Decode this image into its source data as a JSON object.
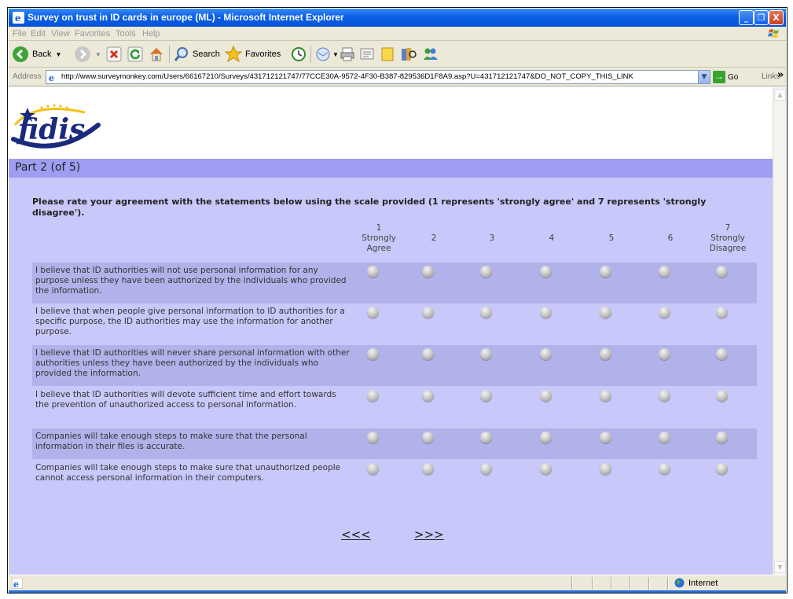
{
  "window": {
    "title": "Survey on trust in ID cards in europe (ML) - Microsoft Internet Explorer",
    "min_label": "_",
    "max_label": "❐",
    "close_label": "X"
  },
  "menu": [
    "File",
    "Edit",
    "View",
    "Favorites",
    "Tools",
    "Help"
  ],
  "toolbar": {
    "back_label": "Back",
    "search_label": "Search",
    "favorites_label": "Favorites"
  },
  "address": {
    "label": "Address",
    "url": "http://www.surveymonkey.com/Users/66167210/Surveys/431712121747/77CCE30A-9572-4F30-B387-829536D1F8A9.asp?U=431712121747&DO_NOT_COPY_THIS_LINK",
    "go_label": "Go",
    "links_label": "Links"
  },
  "page": {
    "logo_text": "fidis",
    "part_title": "Part 2 (of 5)",
    "instructions": "Please rate your agreement with the statements below using the scale provided (1 represents 'strongly agree' and 7 represents 'strongly disagree').",
    "scale": [
      {
        "num": "1",
        "label": "Strongly Agree"
      },
      {
        "num": "2",
        "label": ""
      },
      {
        "num": "3",
        "label": ""
      },
      {
        "num": "4",
        "label": ""
      },
      {
        "num": "5",
        "label": ""
      },
      {
        "num": "6",
        "label": ""
      },
      {
        "num": "7",
        "label": "Strongly Disagree"
      }
    ],
    "questions": [
      "I believe that ID authorities will not use personal information for any purpose unless they have been authorized by the individuals who provided the information.",
      "I believe that when people give personal information to ID authorities for a specific purpose, the ID authorities may use the information for another purpose.",
      "I believe that ID authorities will never share personal information with other authorities unless they have been authorized by the individuals who provided the information.",
      "I believe that ID authorities will devote sufficient time and effort towards the prevention of unauthorized access to personal information.",
      "Companies will take enough steps to make sure that the personal information in their files is accurate.",
      "Companies will take enough steps to make sure that unauthorized people cannot access personal information in their computers."
    ],
    "prev_label": "<<<",
    "next_label": ">>>"
  },
  "status": {
    "zone_label": "Internet"
  },
  "colors": {
    "part_header": "#9d9df2",
    "form_bg": "#c8c8fa",
    "row_shade": "#b2b2ea",
    "titlebar": "#0a5fe6"
  }
}
